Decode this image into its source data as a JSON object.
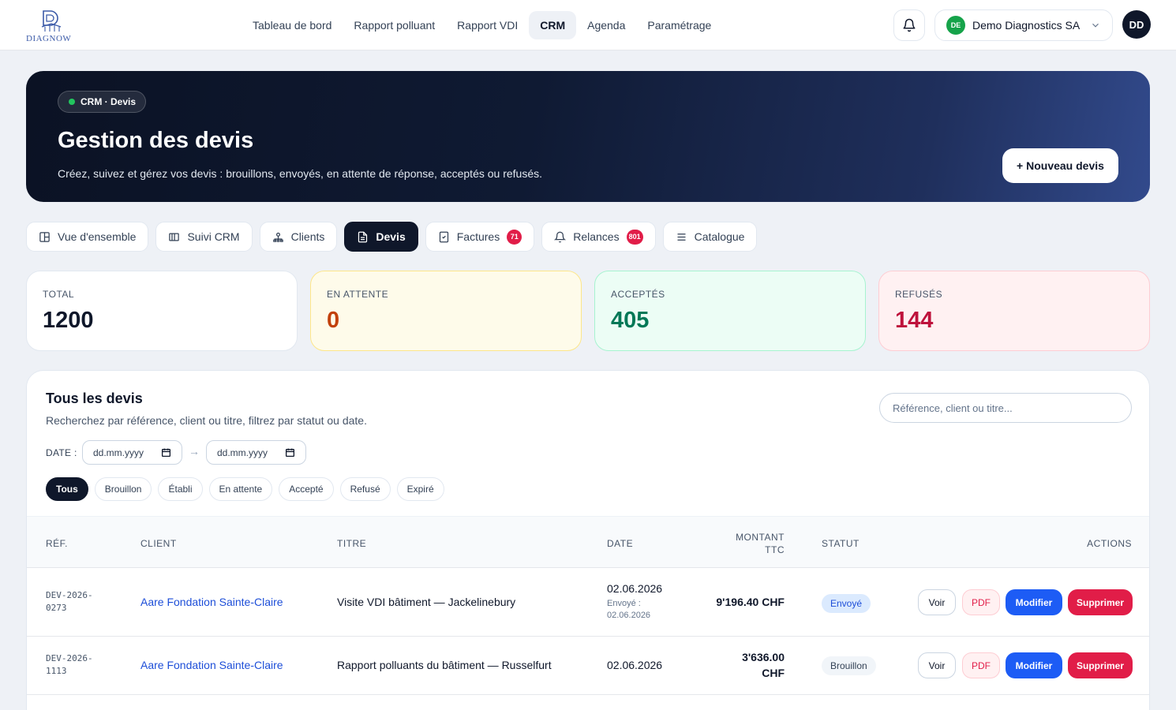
{
  "app": {
    "logo_text": "DIAGNOW",
    "nav": [
      "Tableau de bord",
      "Rapport polluant",
      "Rapport VDI",
      "CRM",
      "Agenda",
      "Paramétrage"
    ],
    "active_nav": "CRM",
    "org": {
      "badge": "DE",
      "name": "Demo Diagnostics SA"
    },
    "avatar": "DD"
  },
  "hero": {
    "pill": "CRM · Devis",
    "title": "Gestion des devis",
    "subtitle": "Créez, suivez et gérez vos devis : brouillons, envoyés, en attente de réponse, acceptés ou refusés.",
    "new_button": "+ Nouveau devis"
  },
  "tabs": [
    {
      "label": "Vue d'ensemble",
      "icon": "layout-icon"
    },
    {
      "label": "Suivi CRM",
      "icon": "kanban-icon"
    },
    {
      "label": "Clients",
      "icon": "users-icon"
    },
    {
      "label": "Devis",
      "icon": "document-icon",
      "active": true
    },
    {
      "label": "Factures",
      "icon": "invoice-icon",
      "count": "71"
    },
    {
      "label": "Relances",
      "icon": "bell-icon",
      "count": "801"
    },
    {
      "label": "Catalogue",
      "icon": "list-icon"
    }
  ],
  "stats": {
    "total": {
      "label": "TOTAL",
      "value": "1200"
    },
    "pending": {
      "label": "EN ATTENTE",
      "value": "0"
    },
    "accepted": {
      "label": "ACCEPTÉS",
      "value": "405"
    },
    "refused": {
      "label": "REFUSÉS",
      "value": "144"
    }
  },
  "list": {
    "title": "Tous les devis",
    "subtitle": "Recherchez par référence, client ou titre, filtrez par statut ou date.",
    "search_placeholder": "Référence, client ou titre...",
    "date_label": "DATE :",
    "date_from": "dd.mm.yyyy",
    "date_to": "dd.mm.yyyy",
    "date_arrow": "→",
    "filters": [
      "Tous",
      "Brouillon",
      "Établi",
      "En attente",
      "Accepté",
      "Refusé",
      "Expiré"
    ],
    "active_filter": "Tous",
    "columns": {
      "ref": "RÉF.",
      "client": "CLIENT",
      "title": "TITRE",
      "date": "DATE",
      "amount_1": "MONTANT",
      "amount_2": "TTC",
      "status": "STATUT",
      "actions": "ACTIONS"
    },
    "actions": {
      "view": "Voir",
      "pdf": "PDF",
      "edit": "Modifier",
      "delete": "Supprimer"
    },
    "rows": [
      {
        "ref_1": "DEV-2026-",
        "ref_2": "0273",
        "client": "Aare Fondation Sainte-Claire",
        "title": "Visite VDI bâtiment — Jackelinebury",
        "date": "02.06.2026",
        "sent_label": "Envoyé :",
        "sent_date": "02.06.2026",
        "amount_1": "9'196.40 CHF",
        "amount_2": "",
        "status": "Envoyé"
      },
      {
        "ref_1": "DEV-2026-",
        "ref_2": "1113",
        "client": "Aare Fondation Sainte-Claire",
        "title": "Rapport polluants du bâtiment — Russelfurt",
        "date": "02.06.2026",
        "sent_label": "",
        "sent_date": "",
        "amount_1": "3'636.00",
        "amount_2": "CHF",
        "status": "Brouillon"
      }
    ]
  }
}
